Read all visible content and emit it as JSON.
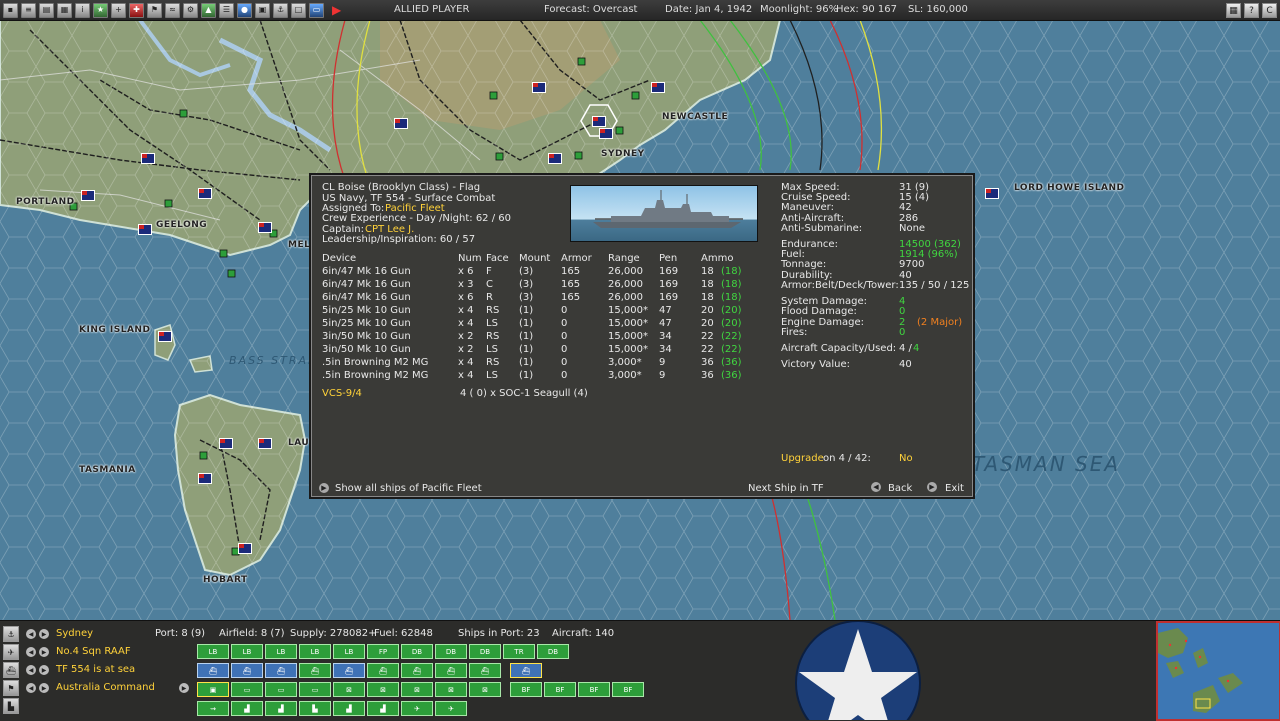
{
  "topbar": {
    "player": "ALLIED PLAYER",
    "forecast": "Forecast: Overcast",
    "date": "Date: Jan 4, 1942",
    "moonlight": "Moonlight: 96%",
    "hex": "Hex: 90 167",
    "sl": "SL: 160,000",
    "close_btn": "C"
  },
  "map": {
    "places": [
      "NEWCASTLE",
      "SYDNEY",
      "LORD HOWE ISLAND",
      "PORTLAND",
      "GEELONG",
      "MEL",
      "KING ISLAND",
      "LAU",
      "TASMANIA",
      "HOBART"
    ],
    "seas": [
      "BASS STRAIT",
      "TASMAN SEA"
    ]
  },
  "ship": {
    "name": "CL Boise (Brooklyn Class) - Flag",
    "navy": "US Navy, TF 554 - Surface Combat",
    "assigned_label": "Assigned To:",
    "assigned_value": "Pacific Fleet",
    "crew": "Crew Experience - Day /Night: 62 / 60",
    "captain_label": "Captain:",
    "captain_value": "CPT Lee J.",
    "leadership": "Leadership/Inspiration: 60 / 57",
    "headers": [
      "Device",
      "Num",
      "Face",
      "Mount",
      "Armor",
      "Range",
      "Pen",
      "Ammo"
    ],
    "devices": [
      {
        "device": "6in/47 Mk 16 Gun",
        "num": "x 6",
        "face": "F",
        "mount": "(3)",
        "armor": "165",
        "range": "26,000",
        "pen": "169",
        "ammo": "18",
        "ammo2": "(18)"
      },
      {
        "device": "6in/47 Mk 16 Gun",
        "num": "x 3",
        "face": "C",
        "mount": "(3)",
        "armor": "165",
        "range": "26,000",
        "pen": "169",
        "ammo": "18",
        "ammo2": "(18)"
      },
      {
        "device": "6in/47 Mk 16 Gun",
        "num": "x 6",
        "face": "R",
        "mount": "(3)",
        "armor": "165",
        "range": "26,000",
        "pen": "169",
        "ammo": "18",
        "ammo2": "(18)"
      },
      {
        "device": "5in/25 Mk 10 Gun",
        "num": "x 4",
        "face": "RS",
        "mount": "(1)",
        "armor": "0",
        "range": "15,000*",
        "pen": "47",
        "ammo": "20",
        "ammo2": "(20)"
      },
      {
        "device": "5in/25 Mk 10 Gun",
        "num": "x 4",
        "face": "LS",
        "mount": "(1)",
        "armor": "0",
        "range": "15,000*",
        "pen": "47",
        "ammo": "20",
        "ammo2": "(20)"
      },
      {
        "device": "3in/50 Mk 10 Gun",
        "num": "x 2",
        "face": "RS",
        "mount": "(1)",
        "armor": "0",
        "range": "15,000*",
        "pen": "34",
        "ammo": "22",
        "ammo2": "(22)"
      },
      {
        "device": "3in/50 Mk 10 Gun",
        "num": "x 2",
        "face": "LS",
        "mount": "(1)",
        "armor": "0",
        "range": "15,000*",
        "pen": "34",
        "ammo": "22",
        "ammo2": "(22)"
      },
      {
        "device": ".5in Browning M2 MG",
        "num": "x 4",
        "face": "RS",
        "mount": "(1)",
        "armor": "0",
        "range": "3,000*",
        "pen": "9",
        "ammo": "36",
        "ammo2": "(36)"
      },
      {
        "device": ".5in Browning M2 MG",
        "num": "x 4",
        "face": "LS",
        "mount": "(1)",
        "armor": "0",
        "range": "3,000*",
        "pen": "9",
        "ammo": "36",
        "ammo2": "(36)"
      }
    ],
    "air_group": "VCS-9/4",
    "air_group_detail": "4 ( 0) x SOC-1 Seagull (4)",
    "stats": {
      "max_speed_label": "Max Speed:",
      "max_speed": "31 (9)",
      "cruise_speed_label": "Cruise Speed:",
      "cruise_speed": "15 (4)",
      "maneuver_label": "Maneuver:",
      "maneuver": "42",
      "aa_label": "Anti-Aircraft:",
      "aa": "286",
      "asub_label": "Anti-Submarine:",
      "asub": "None",
      "endurance_label": "Endurance:",
      "endurance": "14500 (362)",
      "fuel_label": "Fuel:",
      "fuel": "1914 (96%)",
      "tonnage_label": "Tonnage:",
      "tonnage": "9700",
      "durability_label": "Durability:",
      "durability": "40",
      "armor_label": "Armor:Belt/Deck/Tower:",
      "armor": "135 / 50 / 125",
      "sys_dmg_label": "System Damage:",
      "sys_dmg": "4",
      "flood_label": "Flood Damage:",
      "flood": "0",
      "engine_label": "Engine Damage:",
      "engine": "2",
      "engine_major": "(2 Major)",
      "fires_label": "Fires:",
      "fires": "0",
      "aircraft_label": "Aircraft Capacity/Used:",
      "aircraft_cap": "4 /",
      "aircraft_used": "4",
      "vv_label": "Victory Value:",
      "vv": "40"
    },
    "upgrade_label": "Upgrade",
    "upgrade_on": "on 4 / 42:",
    "upgrade_value": "No",
    "show_all": "Show all ships of Pacific Fleet",
    "next_ship": "Next Ship in TF",
    "back": "Back",
    "exit": "Exit"
  },
  "bottom": {
    "rows": [
      {
        "name": "Sydney"
      },
      {
        "name": "No.4 Sqn RAAF"
      },
      {
        "name": "TF 554 is at sea"
      },
      {
        "name": "Australia Command"
      }
    ],
    "port": "Port: 8 (9)",
    "airfield": "Airfield: 8 (7)",
    "supply": "Supply: 278082+",
    "fuel": "Fuel: 62848",
    "ships_in_port": "Ships in Port: 23",
    "aircraft": "Aircraft: 140",
    "row1_units": [
      "LB",
      "LB",
      "LB",
      "LB",
      "LB",
      "FP",
      "DB",
      "DB",
      "DB",
      "TR",
      "DB"
    ],
    "row3_units": [
      "BF",
      "BF",
      "BF",
      "BF"
    ]
  }
}
